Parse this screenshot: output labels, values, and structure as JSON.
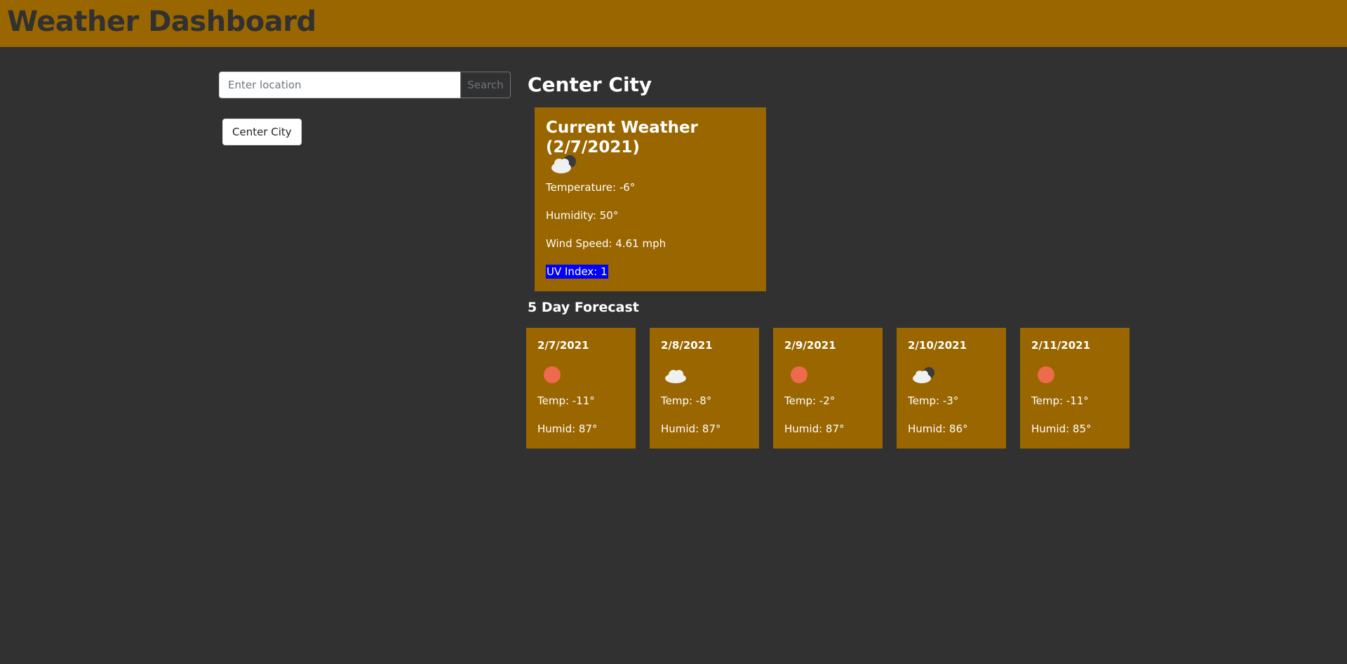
{
  "header": {
    "title": "Weather Dashboard"
  },
  "search": {
    "placeholder": "Enter location",
    "value": "",
    "button_label": "Search"
  },
  "history": {
    "items": [
      {
        "label": "Center City"
      }
    ]
  },
  "city": {
    "name": "Center City"
  },
  "current": {
    "title": "Current Weather (2/7/2021)",
    "icon": "cloud-sun-icon",
    "temperature": "Temperature: -6°",
    "humidity": "Humidity: 50°",
    "wind": "Wind Speed: 4.61 mph",
    "uv": "UV Index: 1",
    "uv_color": "#0000ff"
  },
  "forecast": {
    "title": "5 Day Forecast",
    "days": [
      {
        "date": "2/7/2021",
        "icon": "sun-icon",
        "temp": "Temp: -11°",
        "humid": "Humid: 87°"
      },
      {
        "date": "2/8/2021",
        "icon": "cloud-icon",
        "temp": "Temp: -8°",
        "humid": "Humid: 87°"
      },
      {
        "date": "2/9/2021",
        "icon": "sun-icon",
        "temp": "Temp: -2°",
        "humid": "Humid: 87°"
      },
      {
        "date": "2/10/2021",
        "icon": "cloud-sun-icon",
        "temp": "Temp: -3°",
        "humid": "Humid: 86°"
      },
      {
        "date": "2/11/2021",
        "icon": "sun-icon",
        "temp": "Temp: -11°",
        "humid": "Humid: 85°"
      }
    ]
  },
  "colors": {
    "accent": "#996600",
    "background": "#313131",
    "sun": "#ee6a4c"
  }
}
